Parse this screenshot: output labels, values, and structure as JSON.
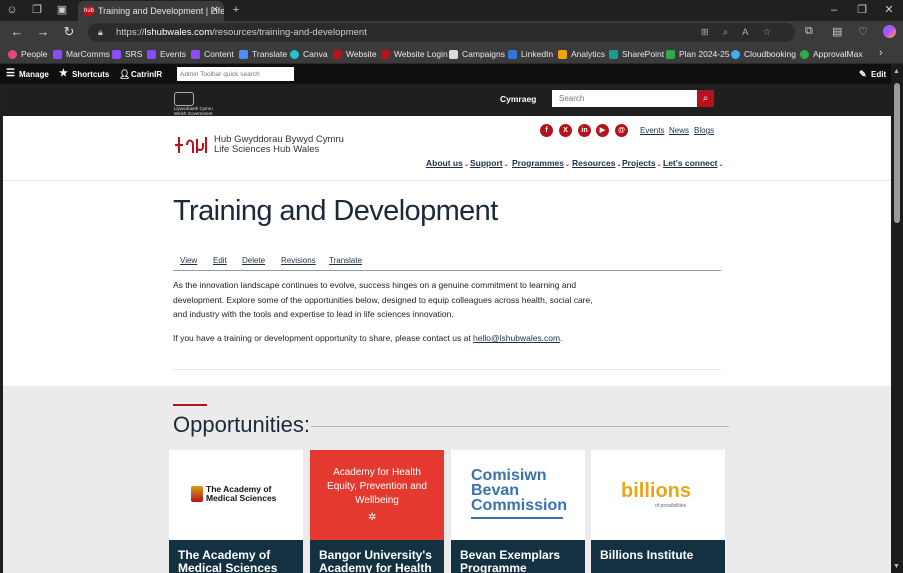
{
  "browser": {
    "tab_title": "Training and Development | Life Sciences Hub Wales",
    "tab_favicon_text": "hub",
    "url_scheme": "https://",
    "url_host": "lshubwales.com",
    "url_path": "/resources/training-and-development",
    "bookmarks": [
      "People",
      "MarComms",
      "SRS",
      "Events",
      "Content",
      "Translate",
      "Canva",
      "Website",
      "Website Login",
      "Campaigns",
      "LinkedIn",
      "Analytics",
      "SharePoint",
      "Plan 2024-25",
      "Cloudbooking",
      "ApprovalMax"
    ]
  },
  "admin": {
    "manage": "Manage",
    "shortcuts": "Shortcuts",
    "user": "CatrinIR",
    "search_placeholder": "Admin Toolbar quick search",
    "edit": "Edit"
  },
  "gov": {
    "logo_line1": "Llywodraeth Cymru",
    "logo_line2": "Welsh Government",
    "lang": "Cymraeg",
    "search_placeholder": "Search"
  },
  "brand": {
    "welsh": "Hub Gwyddorau Bywyd Cymru",
    "english": "Life Sciences Hub Wales"
  },
  "toplinks": [
    "Events",
    "News",
    "Blogs"
  ],
  "menu": [
    "About us",
    "Support",
    "Programmes",
    "Resources",
    "Projects",
    "Let's connect"
  ],
  "page": {
    "title": "Training and Development",
    "tabs": [
      "View",
      "Edit",
      "Delete",
      "Revisions",
      "Translate"
    ],
    "para1": "As the innovation landscape continues to evolve, success hinges on a genuine commitment to learning and development. Explore some of the opportunities below, designed to equip colleagues across health, social care, and industry with the tools and expertise to lead in life sciences innovation.",
    "para2_pre": "If you have a training or development opportunity to share, please contact us at ",
    "email": "hello@lshubwales.com",
    "para2_post": "."
  },
  "opps": {
    "title": "Opportunities:",
    "cards": [
      {
        "caption": "The Academy of Medical Sciences",
        "logo": "The Academy of Medical Sciences"
      },
      {
        "caption": "Bangor University's Academy for Health",
        "logo": "Academy for Health Equity, Prevention and Wellbeing"
      },
      {
        "caption": "Bevan Exemplars Programme",
        "logo": "Comisiwn Bevan Commission"
      },
      {
        "caption": "Billions Institute",
        "logo": "billions",
        "logo_sub": "of possibilities"
      }
    ]
  },
  "colors": {
    "brand_red": "#b5121b",
    "navy": "#1d2f4a",
    "card_caption": "#143142"
  }
}
